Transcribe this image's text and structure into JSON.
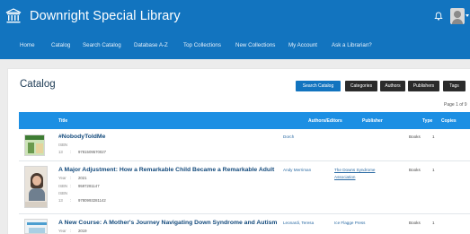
{
  "header": {
    "site_title": "Downright Special Library",
    "logo_icon": "library-logo-icon",
    "notifications_icon": "bell-icon",
    "avatar_icon": "user-avatar-icon"
  },
  "nav": {
    "items": [
      "Home",
      "Catalog",
      "Search Catalog",
      "Database A-Z",
      "Top Collections",
      "New Collections",
      "My Account",
      "Ask a Librarian?"
    ]
  },
  "main": {
    "heading": "Catalog",
    "buttons": {
      "search_catalog": "Search Catalog",
      "categories": "Categories",
      "authors": "Authors",
      "publishers": "Publishers",
      "tags": "Tags"
    },
    "page_count": "Page 1 of 9"
  },
  "table": {
    "columns": {
      "title": "Title",
      "authors": "Authors/Editors",
      "publisher": "Publisher",
      "type": "Type",
      "copies": "Copies"
    },
    "rows": [
      {
        "title": "#NobodyToldMe",
        "meta": [
          {
            "key": "ISBN",
            "value": ""
          },
          {
            "key": "13",
            "value": "9781509570027"
          }
        ],
        "authors": "Dorch",
        "publisher": "",
        "type": "Books",
        "copies": "1"
      },
      {
        "title": "A Major Adjustment: How a Remarkable Child Became a Remarkable Adult",
        "meta": [
          {
            "key": "Year",
            "value": "2021"
          },
          {
            "key": "ISBN",
            "value": "9597281147"
          },
          {
            "key": "ISBN",
            "value": ""
          },
          {
            "key": "13",
            "value": "9780993281142"
          }
        ],
        "authors": "Andy Merriman",
        "publisher_lines": [
          "The Downs Syndrome",
          "Association"
        ],
        "type": "Books",
        "copies": "1"
      },
      {
        "title": "A New Course: A Mother's Journey Navigating Down Syndrome and Autism",
        "meta": [
          {
            "key": "Year",
            "value": "2019"
          }
        ],
        "authors": "Leonardi, Teresa",
        "publisher": "Ice Flagge Press",
        "type": "Books",
        "copies": "1"
      }
    ]
  },
  "colors": {
    "header_blue": "#1274bf",
    "table_header_blue": "#1c8fe3",
    "dark_button": "#2b2b2b",
    "link_blue": "#134a7c"
  }
}
